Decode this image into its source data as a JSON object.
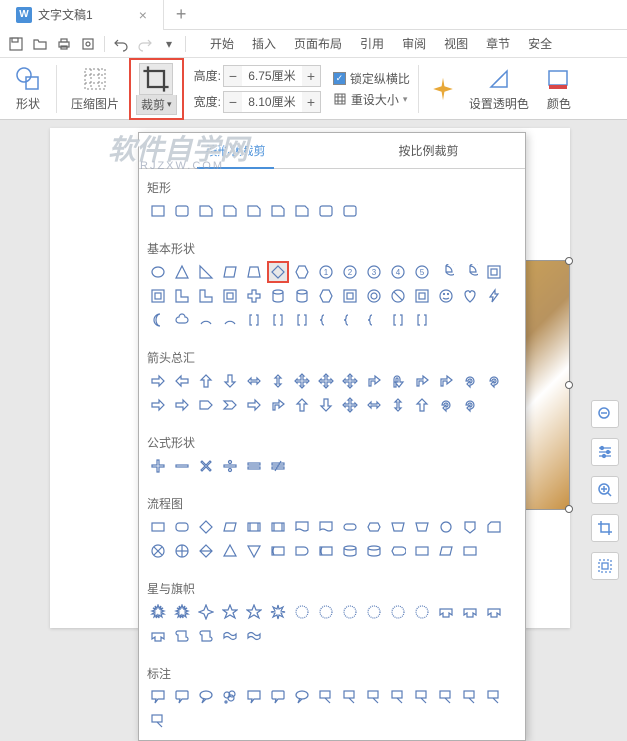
{
  "tab": {
    "icon": "W",
    "title": "文字文稿1"
  },
  "menu": {
    "items": [
      "开始",
      "插入",
      "页面布局",
      "引用",
      "审阅",
      "视图",
      "章节",
      "安全"
    ]
  },
  "ribbon": {
    "shape_label": "形状",
    "compress_label": "压缩图片",
    "crop_label": "裁剪",
    "height_label": "高度:",
    "width_label": "宽度:",
    "height_value": "6.75厘米",
    "width_value": "8.10厘米",
    "lock_ratio_label": "锁定纵横比",
    "reset_size_label": "重设大小",
    "transparency_label": "设置透明色",
    "color_label": "颜色"
  },
  "dropdown": {
    "tabs": [
      "按形状裁剪",
      "按比例裁剪"
    ],
    "categories": [
      {
        "label": "矩形",
        "count": 9
      },
      {
        "label": "基本形状",
        "count": 42,
        "highlight_index": 5
      },
      {
        "label": "箭头总汇",
        "count": 29
      },
      {
        "label": "公式形状",
        "count": 6
      },
      {
        "label": "流程图",
        "count": 29
      },
      {
        "label": "星与旗帜",
        "count": 20
      },
      {
        "label": "标注",
        "count": 16
      }
    ]
  },
  "watermark": {
    "main": "软件自学网",
    "sub": "RJZXW.COM"
  }
}
